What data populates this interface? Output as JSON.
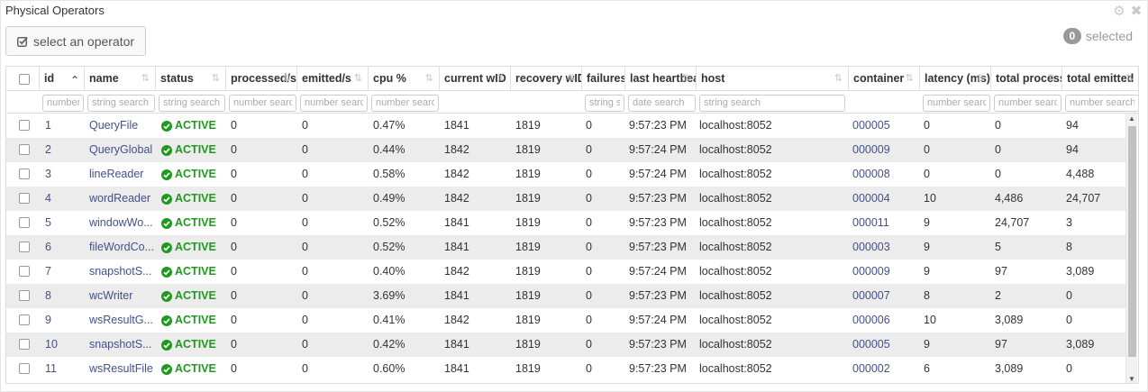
{
  "panel": {
    "title": "Physical Operators",
    "select_button_label": "select an operator",
    "selected_count": "0",
    "selected_label": "selected"
  },
  "columns": [
    {
      "key": "id",
      "label": "id",
      "filter": "number search",
      "sorted": true
    },
    {
      "key": "name",
      "label": "name",
      "filter": "string search"
    },
    {
      "key": "status",
      "label": "status",
      "filter": "string search"
    },
    {
      "key": "processed",
      "label": "processed/s",
      "filter": "number search"
    },
    {
      "key": "emitted",
      "label": "emitted/s",
      "filter": "number search"
    },
    {
      "key": "cpu",
      "label": "cpu %",
      "filter": "number search"
    },
    {
      "key": "current_wid",
      "label": "current wID",
      "filter": ""
    },
    {
      "key": "recovery_wid",
      "label": "recovery wID",
      "filter": ""
    },
    {
      "key": "failures",
      "label": "failures",
      "filter": "string search"
    },
    {
      "key": "heartbeat",
      "label": "last heartbeat",
      "filter": "date search"
    },
    {
      "key": "host",
      "label": "host",
      "filter": "string search"
    },
    {
      "key": "container",
      "label": "container",
      "filter": ""
    },
    {
      "key": "latency",
      "label": "latency (ms)",
      "filter": "number search"
    },
    {
      "key": "total_processed",
      "label": "total processed",
      "filter": "number search"
    },
    {
      "key": "total_emitted",
      "label": "total emitted",
      "filter": "number search"
    }
  ],
  "status_label": "ACTIVE",
  "rows": [
    {
      "id": "1",
      "name": "QueryFile",
      "processed": "0",
      "emitted": "0",
      "cpu": "0.47%",
      "current_wid": "1841",
      "recovery_wid": "1819",
      "failures": "0",
      "heartbeat": "9:57:23 PM",
      "host": "localhost:8052",
      "container": "000005",
      "latency": "0",
      "total_processed": "0",
      "total_emitted": "94"
    },
    {
      "id": "2",
      "name": "QueryGlobal",
      "processed": "0",
      "emitted": "0",
      "cpu": "0.44%",
      "current_wid": "1842",
      "recovery_wid": "1819",
      "failures": "0",
      "heartbeat": "9:57:24 PM",
      "host": "localhost:8052",
      "container": "000009",
      "latency": "0",
      "total_processed": "0",
      "total_emitted": "94"
    },
    {
      "id": "3",
      "name": "lineReader",
      "processed": "0",
      "emitted": "0",
      "cpu": "0.58%",
      "current_wid": "1842",
      "recovery_wid": "1819",
      "failures": "0",
      "heartbeat": "9:57:24 PM",
      "host": "localhost:8052",
      "container": "000008",
      "latency": "0",
      "total_processed": "0",
      "total_emitted": "4,488"
    },
    {
      "id": "4",
      "name": "wordReader",
      "processed": "0",
      "emitted": "0",
      "cpu": "0.49%",
      "current_wid": "1842",
      "recovery_wid": "1819",
      "failures": "0",
      "heartbeat": "9:57:23 PM",
      "host": "localhost:8052",
      "container": "000004",
      "latency": "10",
      "total_processed": "4,486",
      "total_emitted": "24,707"
    },
    {
      "id": "5",
      "name": "windowWo...",
      "processed": "0",
      "emitted": "0",
      "cpu": "0.52%",
      "current_wid": "1841",
      "recovery_wid": "1819",
      "failures": "0",
      "heartbeat": "9:57:23 PM",
      "host": "localhost:8052",
      "container": "000011",
      "latency": "9",
      "total_processed": "24,707",
      "total_emitted": "3"
    },
    {
      "id": "6",
      "name": "fileWordCo...",
      "processed": "0",
      "emitted": "0",
      "cpu": "0.52%",
      "current_wid": "1841",
      "recovery_wid": "1819",
      "failures": "0",
      "heartbeat": "9:57:23 PM",
      "host": "localhost:8052",
      "container": "000003",
      "latency": "9",
      "total_processed": "5",
      "total_emitted": "8"
    },
    {
      "id": "7",
      "name": "snapshotS...",
      "processed": "0",
      "emitted": "0",
      "cpu": "0.40%",
      "current_wid": "1842",
      "recovery_wid": "1819",
      "failures": "0",
      "heartbeat": "9:57:24 PM",
      "host": "localhost:8052",
      "container": "000009",
      "latency": "9",
      "total_processed": "97",
      "total_emitted": "3,089"
    },
    {
      "id": "8",
      "name": "wcWriter",
      "processed": "0",
      "emitted": "0",
      "cpu": "3.69%",
      "current_wid": "1841",
      "recovery_wid": "1819",
      "failures": "0",
      "heartbeat": "9:57:23 PM",
      "host": "localhost:8052",
      "container": "000007",
      "latency": "8",
      "total_processed": "2",
      "total_emitted": "0"
    },
    {
      "id": "9",
      "name": "wsResultG...",
      "processed": "0",
      "emitted": "0",
      "cpu": "0.41%",
      "current_wid": "1842",
      "recovery_wid": "1819",
      "failures": "0",
      "heartbeat": "9:57:24 PM",
      "host": "localhost:8052",
      "container": "000006",
      "latency": "10",
      "total_processed": "3,089",
      "total_emitted": "0"
    },
    {
      "id": "10",
      "name": "snapshotS...",
      "processed": "0",
      "emitted": "0",
      "cpu": "0.42%",
      "current_wid": "1841",
      "recovery_wid": "1819",
      "failures": "0",
      "heartbeat": "9:57:23 PM",
      "host": "localhost:8052",
      "container": "000005",
      "latency": "9",
      "total_processed": "97",
      "total_emitted": "3,089"
    },
    {
      "id": "11",
      "name": "wsResultFile",
      "processed": "0",
      "emitted": "0",
      "cpu": "0.60%",
      "current_wid": "1841",
      "recovery_wid": "1819",
      "failures": "0",
      "heartbeat": "9:57:23 PM",
      "host": "localhost:8052",
      "container": "000002",
      "latency": "6",
      "total_processed": "3,089",
      "total_emitted": "0"
    }
  ],
  "colors": {
    "active": "#1f9a1f",
    "link": "#44508a",
    "stripe": "#ececec"
  }
}
